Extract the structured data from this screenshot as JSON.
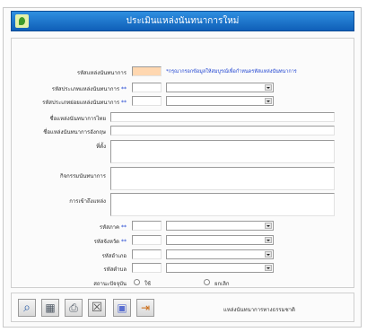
{
  "window": {
    "title": "ประเมินแหล่งนันทนาการใหม่"
  },
  "form": {
    "source_code": {
      "label": "รหัสแหล่งนันทนาการ",
      "value": "",
      "hint": "*กรุณากรอกข้อมูลให้สมบูรณ์เพื่อกำหนดรหัสแหล่งนันทนาการ"
    },
    "type_code": {
      "label": "รหัสประเภทแหล่งนันทนาการ",
      "required": "**",
      "value": "",
      "selected": ""
    },
    "subtype_code": {
      "label": "รหัสประเภทย่อยแหล่งนันทนาการ",
      "required": "**",
      "value": "",
      "selected": ""
    },
    "name_th": {
      "label": "ชื่อแหล่งนันทนาการไทย",
      "value": ""
    },
    "name_en": {
      "label": "ชื่อแหล่งนันทนาการอังกฤษ",
      "value": ""
    },
    "address": {
      "label": "ที่ตั้ง",
      "value": ""
    },
    "activities": {
      "label": "กิจกรรมนันทนาการ",
      "value": ""
    },
    "travel": {
      "label": "การเข้าถึงแหล่ง",
      "value": ""
    },
    "region_code": {
      "label": "รหัสภาค",
      "required": "**",
      "value": "",
      "selected": ""
    },
    "province_code": {
      "label": "รหัสจังหวัด",
      "required": "**",
      "value": "",
      "selected": ""
    },
    "district_code": {
      "label": "รหัสอำเภอ",
      "required": "",
      "value": "",
      "selected": ""
    },
    "subdistrict_code": {
      "label": "รหัสตำบล",
      "required": "",
      "value": "",
      "selected": ""
    },
    "status": {
      "label": "สถานะปัจจุบัน",
      "options": [
        "ใช้",
        "ยกเลิก"
      ],
      "selected": ""
    }
  },
  "toolbar": {
    "buttons": [
      "search",
      "save",
      "print",
      "delete",
      "grid",
      "exit"
    ],
    "footer_text": "แหล่งนันทนาการทางธรรมชาติ"
  },
  "colors": {
    "titlebar": "#1f78d1",
    "required": "#1a3fd0",
    "source_code_bg": "#ffd7b0"
  }
}
